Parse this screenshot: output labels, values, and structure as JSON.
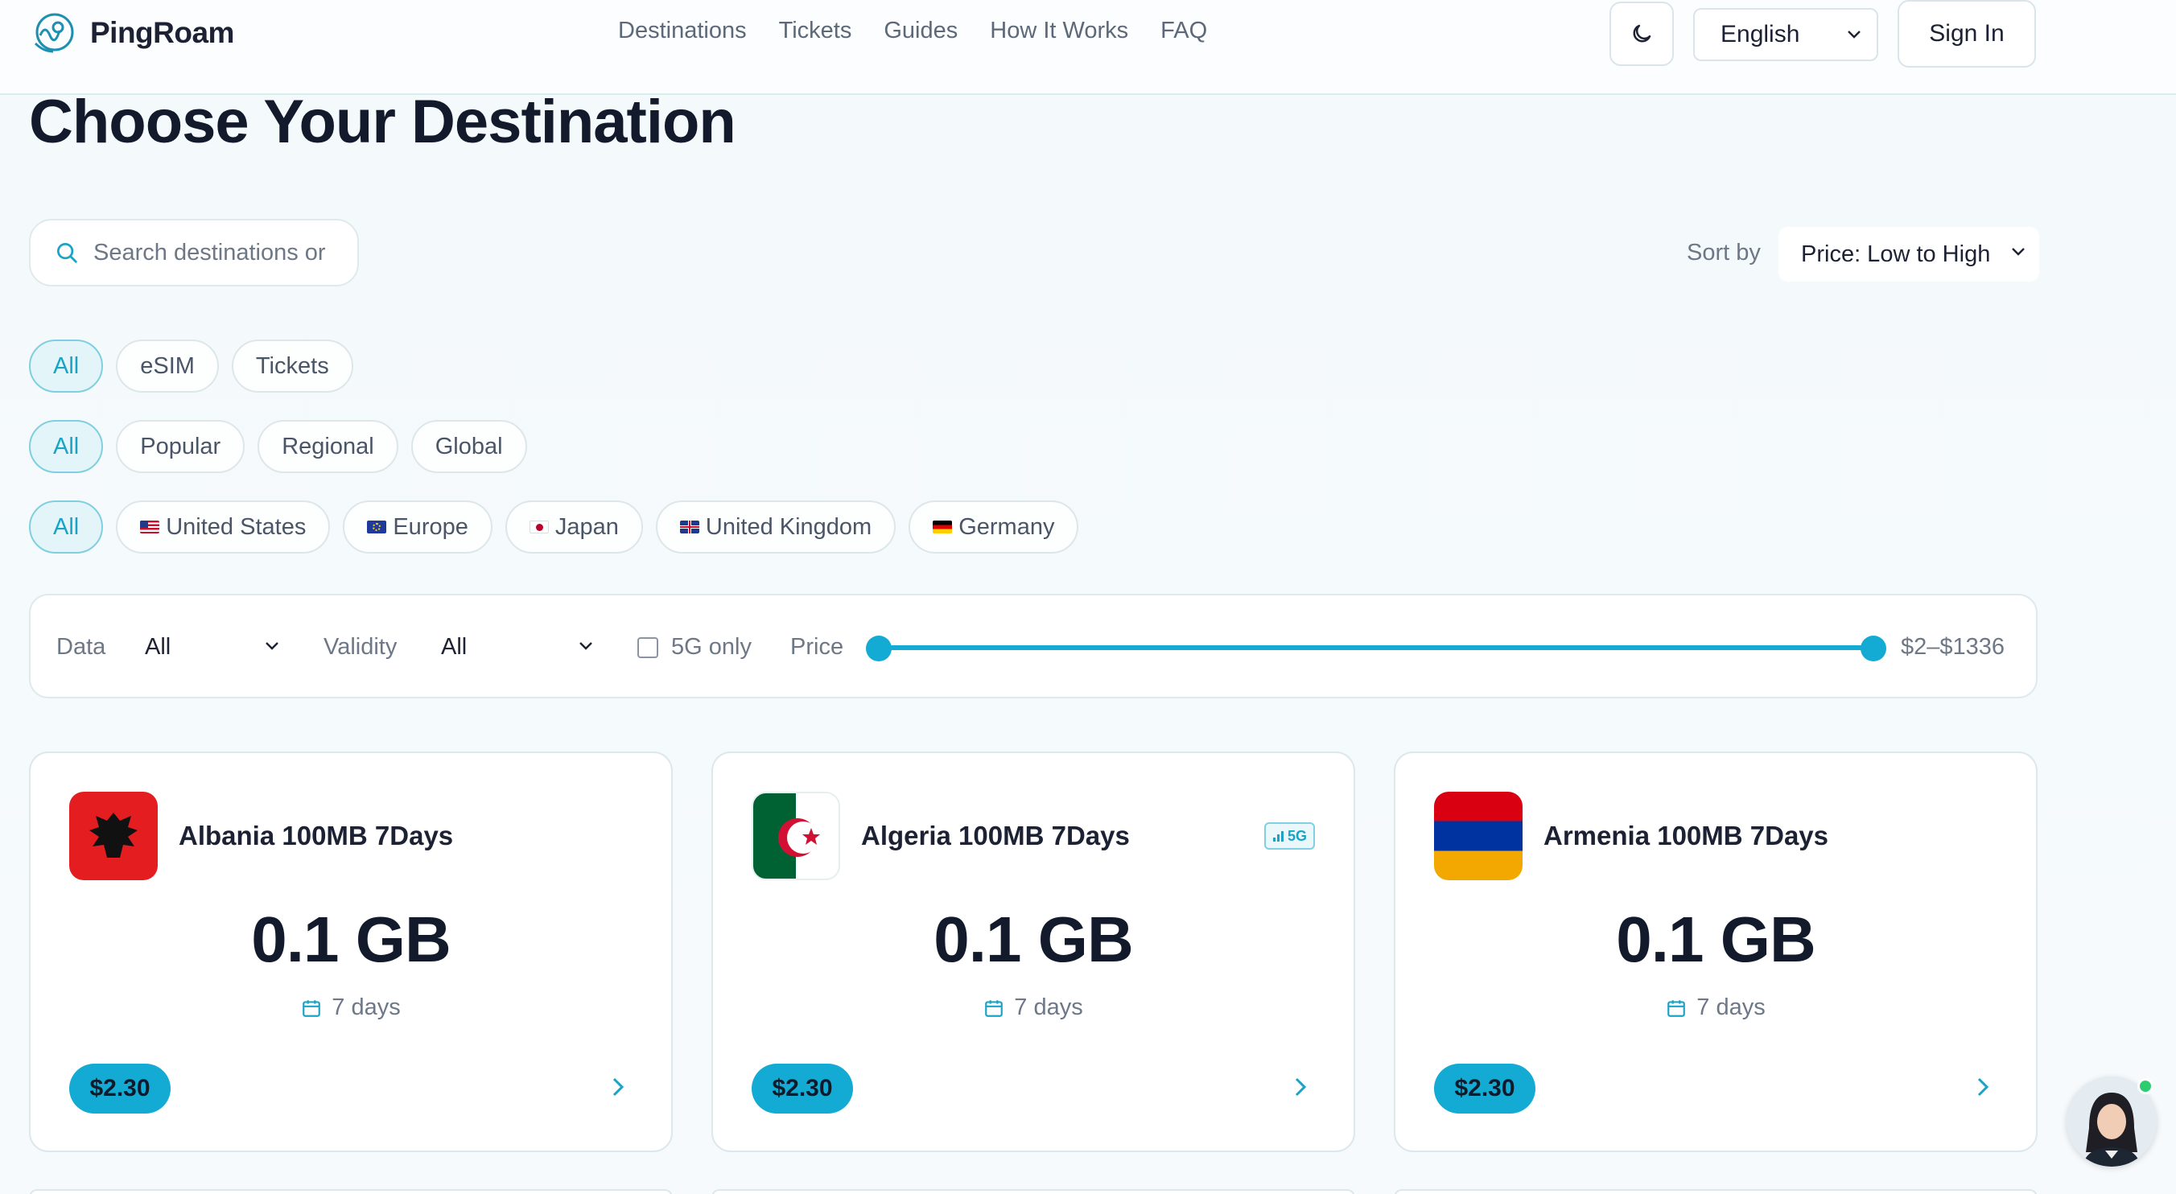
{
  "app": {
    "name": "PingRoam"
  },
  "nav": [
    "Destinations",
    "Tickets",
    "Guides",
    "How It Works",
    "FAQ"
  ],
  "header": {
    "language": "English",
    "sign_in": "Sign In",
    "theme_icon": "moon-icon"
  },
  "page_title": "Choose Your Destination",
  "search": {
    "placeholder": "Search destinations or"
  },
  "sort": {
    "label": "Sort by",
    "value": "Price: Low to High"
  },
  "chip_rows": {
    "type": [
      "All",
      "eSIM",
      "Tickets"
    ],
    "scope": [
      "All",
      "Popular",
      "Regional",
      "Global"
    ],
    "region": [
      "All",
      "United States",
      "Europe",
      "Japan",
      "United Kingdom",
      "Germany"
    ]
  },
  "filters": {
    "data_label": "Data",
    "data_value": "All",
    "validity_label": "Validity",
    "validity_value": "All",
    "five_g_label": "5G only",
    "five_g_checked": false,
    "price_label": "Price",
    "price_range": "$2–$1336",
    "price_min": 2,
    "price_max": 1336
  },
  "cards": [
    {
      "title": "Albania 100MB 7Days",
      "data": "0.1 GB",
      "validity": "7 days",
      "price": "$2.30",
      "five_g": false,
      "flag": "albania"
    },
    {
      "title": "Algeria 100MB 7Days",
      "data": "0.1 GB",
      "validity": "7 days",
      "price": "$2.30",
      "five_g": true,
      "badge": "5G",
      "flag": "algeria"
    },
    {
      "title": "Armenia 100MB 7Days",
      "data": "0.1 GB",
      "validity": "7 days",
      "price": "$2.30",
      "five_g": false,
      "flag": "armenia"
    }
  ],
  "colors": {
    "accent": "#13abd3",
    "chip_active_bg": "#e3f5f9",
    "text_dark": "#121a2b",
    "muted": "#6d7786"
  }
}
